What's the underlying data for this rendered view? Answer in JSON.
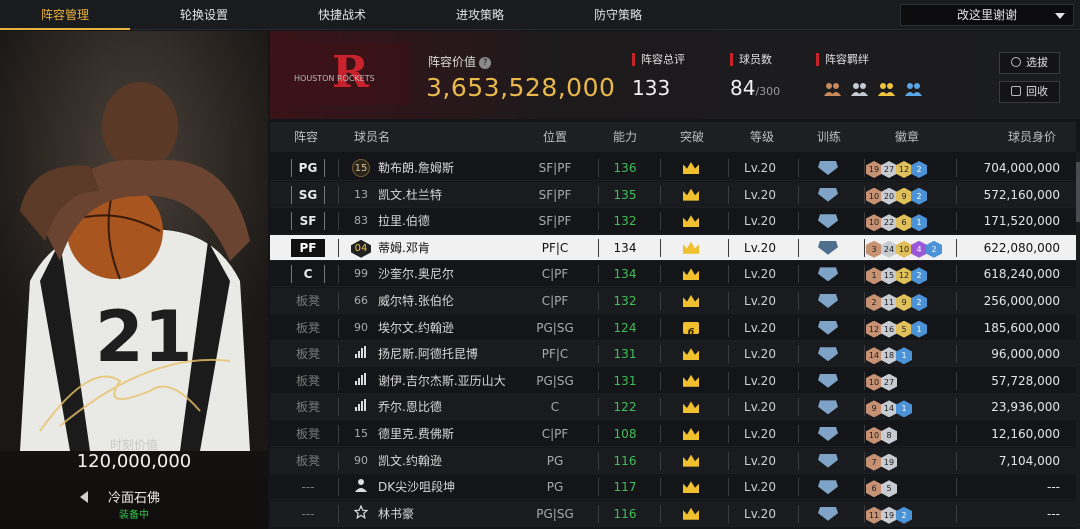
{
  "tabs": [
    {
      "label": "阵容管理",
      "active": true
    },
    {
      "label": "轮换设置",
      "active": false
    },
    {
      "label": "快捷战术",
      "active": false
    },
    {
      "label": "进攻策略",
      "active": false
    },
    {
      "label": "防守策略",
      "active": false
    }
  ],
  "team_selector": {
    "value": "改这里谢谢"
  },
  "left_panel": {
    "price_label": "时刻价值",
    "price": "120,000,000",
    "player_name": "冷面石佛",
    "status": "装备中"
  },
  "team": {
    "logo_text": "HOUSTON ROCKETS",
    "value_label": "阵容价值",
    "value": "3,653,528,000",
    "rating_label": "阵容总评",
    "rating": "133",
    "count_label": "球员数",
    "count": "84",
    "count_max": "/300",
    "bond_label": "阵容羁绊",
    "pick_button": "选拔",
    "recycle_button": "回收"
  },
  "table": {
    "headers": {
      "lineup": "阵容",
      "name": "球员名",
      "position": "位置",
      "ability": "能力",
      "breakthrough": "突破",
      "level": "等级",
      "training": "训练",
      "badges": "徽章",
      "value": "球员身价"
    },
    "rows": [
      {
        "slot": "PG",
        "starter": true,
        "num": "15",
        "num_style": "badge",
        "name": "勒布朗.詹姆斯",
        "pos": "SF|PF",
        "ability": "136",
        "crown": "crown",
        "level": "Lv.20",
        "badges": [
          [
            "b",
            "19"
          ],
          [
            "s",
            "27"
          ],
          [
            "g",
            "12"
          ],
          [
            "bl",
            "2"
          ]
        ],
        "value": "704,000,000"
      },
      {
        "slot": "SG",
        "starter": true,
        "num": "13",
        "num_style": "plain",
        "name": "凯文.杜兰特",
        "pos": "SF|PF",
        "ability": "135",
        "crown": "crown",
        "level": "Lv.20",
        "badges": [
          [
            "b",
            "10"
          ],
          [
            "s",
            "20"
          ],
          [
            "g",
            "9"
          ],
          [
            "bl",
            "2"
          ]
        ],
        "value": "572,160,000"
      },
      {
        "slot": "SF",
        "starter": true,
        "num": "83",
        "num_style": "plain",
        "name": "拉里.伯德",
        "pos": "SF|PF",
        "ability": "132",
        "crown": "crown",
        "level": "Lv.20",
        "badges": [
          [
            "b",
            "10"
          ],
          [
            "s",
            "22"
          ],
          [
            "g",
            "6"
          ],
          [
            "bl",
            "1"
          ]
        ],
        "value": "171,520,000"
      },
      {
        "slot": "PF",
        "starter": true,
        "selected": true,
        "num": "04",
        "num_style": "hex",
        "name": "蒂姆.邓肯",
        "pos": "PF|C",
        "ability": "134",
        "crown": "crown",
        "level": "Lv.20",
        "badges": [
          [
            "b",
            "3"
          ],
          [
            "s",
            "24"
          ],
          [
            "g",
            "10"
          ],
          [
            "pu",
            "4"
          ],
          [
            "bl",
            "2"
          ]
        ],
        "value": "622,080,000"
      },
      {
        "slot": "C",
        "starter": true,
        "num": "99",
        "num_style": "plain",
        "name": "沙奎尔.奥尼尔",
        "pos": "C|PF",
        "ability": "134",
        "crown": "crown",
        "level": "Lv.20",
        "badges": [
          [
            "b",
            "1"
          ],
          [
            "s",
            "15"
          ],
          [
            "g",
            "12"
          ],
          [
            "bl",
            "2"
          ]
        ],
        "value": "618,240,000"
      },
      {
        "slot": "板凳",
        "starter": false,
        "num": "66",
        "num_style": "plain",
        "name": "威尔特.张伯伦",
        "pos": "C|PF",
        "ability": "132",
        "crown": "crown",
        "level": "Lv.20",
        "badges": [
          [
            "b",
            "2"
          ],
          [
            "s",
            "11"
          ],
          [
            "g",
            "9"
          ],
          [
            "bl",
            "2"
          ]
        ],
        "value": "256,000,000"
      },
      {
        "slot": "板凳",
        "starter": false,
        "num": "90",
        "num_style": "plain",
        "name": "埃尔文.约翰逊",
        "pos": "PG|SG",
        "ability": "124",
        "crown": "six",
        "level": "Lv.20",
        "badges": [
          [
            "b",
            "12"
          ],
          [
            "s",
            "16"
          ],
          [
            "g",
            "5"
          ],
          [
            "bl",
            "1"
          ]
        ],
        "value": "185,600,000"
      },
      {
        "slot": "板凳",
        "starter": false,
        "num": "",
        "num_style": "bars",
        "name": "扬尼斯.阿德托昆博",
        "pos": "PF|C",
        "ability": "131",
        "crown": "crown",
        "level": "Lv.20",
        "badges": [
          [
            "b",
            "14"
          ],
          [
            "s",
            "18"
          ],
          [
            "bl",
            "1"
          ]
        ],
        "value": "96,000,000"
      },
      {
        "slot": "板凳",
        "starter": false,
        "num": "",
        "num_style": "bars",
        "name": "谢伊.吉尔杰斯.亚历山大",
        "pos": "PG|SG",
        "ability": "131",
        "crown": "crown",
        "level": "Lv.20",
        "badges": [
          [
            "b",
            "10"
          ],
          [
            "s",
            "27"
          ]
        ],
        "value": "57,728,000"
      },
      {
        "slot": "板凳",
        "starter": false,
        "num": "",
        "num_style": "bars",
        "name": "乔尔.恩比德",
        "pos": "C",
        "ability": "122",
        "crown": "crown",
        "level": "Lv.20",
        "badges": [
          [
            "b",
            "9"
          ],
          [
            "s",
            "14"
          ],
          [
            "bl",
            "1"
          ]
        ],
        "value": "23,936,000"
      },
      {
        "slot": "板凳",
        "starter": false,
        "num": "15",
        "num_style": "plain",
        "name": "德里克.费佛斯",
        "pos": "C|PF",
        "ability": "108",
        "crown": "crown",
        "level": "Lv.20",
        "badges": [
          [
            "b",
            "10"
          ],
          [
            "s",
            "8"
          ]
        ],
        "value": "12,160,000"
      },
      {
        "slot": "板凳",
        "starter": false,
        "num": "90",
        "num_style": "plain",
        "name": "凯文.约翰逊",
        "pos": "PG",
        "ability": "116",
        "crown": "crown",
        "level": "Lv.20",
        "badges": [
          [
            "b",
            "7"
          ],
          [
            "s",
            "19"
          ]
        ],
        "value": "7,104,000"
      },
      {
        "slot": "---",
        "starter": false,
        "num": "",
        "num_style": "person",
        "name": "DK尖沙咀段坤",
        "pos": "PG",
        "ability": "117",
        "crown": "crown",
        "level": "Lv.20",
        "badges": [
          [
            "b",
            "6"
          ],
          [
            "s",
            "5"
          ]
        ],
        "value": "---"
      },
      {
        "slot": "---",
        "starter": false,
        "num": "",
        "num_style": "star",
        "name": "林书豪",
        "pos": "PG|SG",
        "ability": "116",
        "crown": "crown",
        "level": "Lv.20",
        "badges": [
          [
            "b",
            "11"
          ],
          [
            "s",
            "19"
          ],
          [
            "bl",
            "2"
          ]
        ],
        "value": "---"
      }
    ]
  },
  "colors": {
    "accent_gold": "#e9b13f",
    "ability_green": "#3fbf5a",
    "rockets_red": "#c8232c"
  }
}
